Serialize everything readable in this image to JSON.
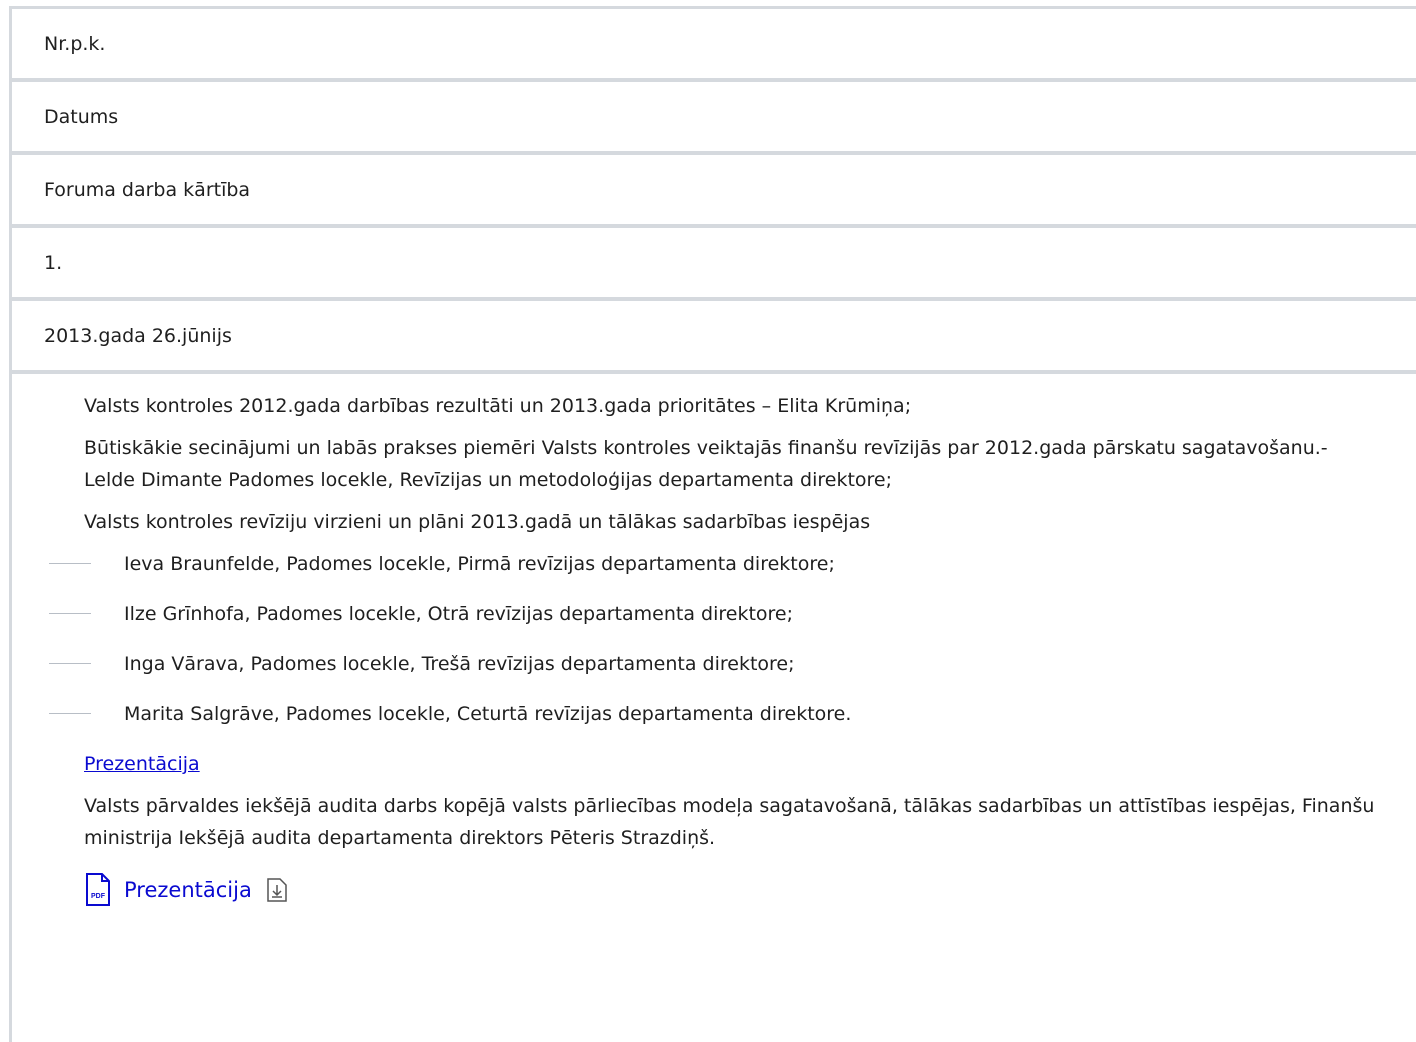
{
  "rows": {
    "header_nr": "Nr.p.k.",
    "header_date": "Datums",
    "header_agenda": "Foruma darba kārtība",
    "row1_nr": "1.",
    "row1_date": "2013.gada 26.jūnijs"
  },
  "agenda": {
    "item1": "Valsts kontroles 2012.gada darbības rezultāti un 2013.gada prioritātes – Elita Krūmiņa;",
    "item2": "Būtiskākie secinājumi un labās prakses piemēri Valsts kontroles veiktajās finanšu revīzijās par 2012.gada pārskatu sagatavošanu.- Lelde Dimante Padomes locekle, Revīzijas un metodoloģijas departamenta direktore;",
    "item3": "Valsts kontroles revīziju virzieni un plāni 2013.gadā un tālākas sadarbības iespējas",
    "speakers": [
      "Ieva Braunfelde, Padomes locekle, Pirmā revīzijas departamenta direktore;",
      "Ilze Grīnhofa, Padomes locekle, Otrā revīzijas departamenta direktore;",
      "Inga Vārava, Padomes locekle, Trešā revīzijas departamenta direktore;",
      "Marita Salgrāve, Padomes locekle, Ceturtā revīzijas departamenta direktore."
    ],
    "link1_label": "Prezentācija",
    "item4": "Valsts pārvaldes iekšējā audita darbs kopējā valsts pārliecības modeļa sagatavošanā, tālākas sadarbības un attīstības iespējas, Finanšu ministrija Iekšējā audita departamenta direktors Pēteris Strazdiņš.",
    "link2_label": "Prezentācija",
    "pdf_badge": "PDF"
  },
  "colors": {
    "link": "#0a0ad0",
    "border": "#d5d9de"
  }
}
